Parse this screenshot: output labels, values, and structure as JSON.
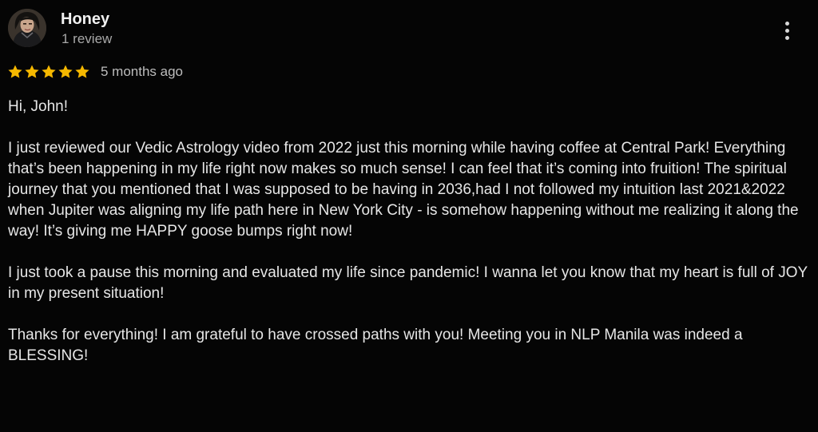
{
  "reviewer": {
    "name": "Honey",
    "review_count": "1 review",
    "avatar_icon": "user-avatar-photo"
  },
  "rating": {
    "stars": 5,
    "max": 5,
    "star_color": "#f5b800",
    "date": "5 months ago"
  },
  "menu": {
    "icon": "more-vert-icon"
  },
  "review": {
    "paragraphs": [
      "Hi, John!",
      "I just reviewed our Vedic Astrology video from 2022 just this morning while having coffee at Central Park! Everything that’s been happening in my life right now makes so much sense! I can feel that it’s coming into fruition! The spiritual journey that you mentioned that I was supposed to be having in 2036,had I not followed my intuition last 2021&2022 when Jupiter was aligning my life path here in New York City - is somehow happening without me realizing it along the way! It’s giving me HAPPY goose bumps right now!",
      "I just took a pause this morning and evaluated my life since pandemic! I wanna let you know that my heart is full of JOY in my present situation!",
      "Thanks for everything! I am grateful to have crossed paths with you! Meeting you in NLP Manila was indeed a BLESSING!"
    ]
  }
}
